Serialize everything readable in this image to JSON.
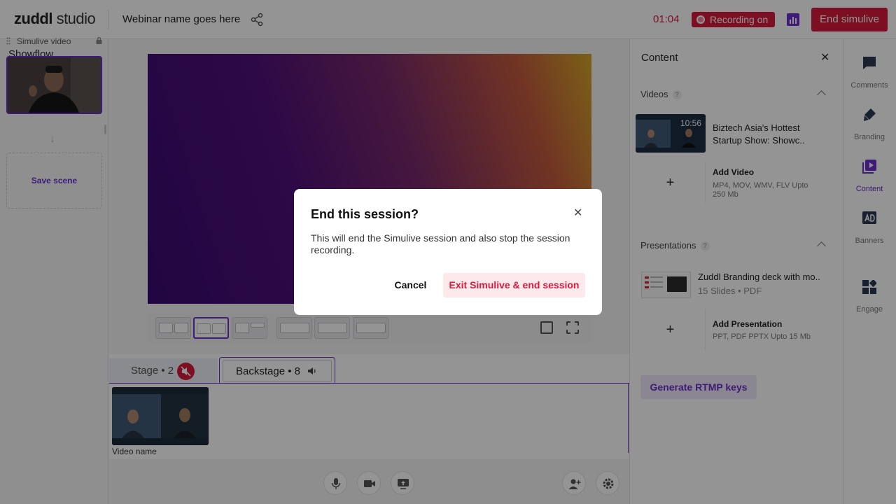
{
  "header": {
    "logo_main": "zuddl",
    "logo_sub": "studio",
    "webinar_title": "Webinar name goes here",
    "timer": "01:04",
    "recording_label": "Recording on",
    "end_label": "End simulive"
  },
  "showflow": {
    "title": "Showflow",
    "item_label": "Simulive video",
    "arrow": "↓",
    "save_label": "Save scene"
  },
  "tabs": {
    "stage_label": "Stage • 2",
    "backstage_label": "Backstage • 8",
    "video_name": "Video name"
  },
  "content_panel": {
    "title": "Content",
    "close": "✕",
    "videos_label": "Videos",
    "help": "?",
    "video_duration": "10:56",
    "video_title_1": "Biztech Asia's Hottest",
    "video_title_2": "Startup Show: Showc..",
    "add_plus": "+",
    "add_video_title": "Add Video",
    "add_video_sub_1": "MP4, MOV, WMV, FLV Upto",
    "add_video_sub_2": "250 Mb",
    "presentations_label": "Presentations",
    "ppt_name": "Zuddl Branding deck with mo..",
    "ppt_sub": "15 Slides • PDF",
    "add_ppt_title": "Add Presentation",
    "add_ppt_sub": "PPT, PDF PPTX Upto 15 Mb",
    "rtmp_label": "Generate RTMP keys"
  },
  "nav": {
    "comments": "Comments",
    "branding": "Branding",
    "content": "Content",
    "banners": "Banners",
    "engage": "Engage"
  },
  "modal": {
    "title": "End this session?",
    "close": "✕",
    "body": "This will end the Simulive session and also stop the session recording.",
    "cancel_label": "Cancel",
    "exit_label": "Exit Simulive & end session"
  },
  "colors": {
    "accent": "#6a2fcc",
    "danger": "#d81b3c"
  }
}
